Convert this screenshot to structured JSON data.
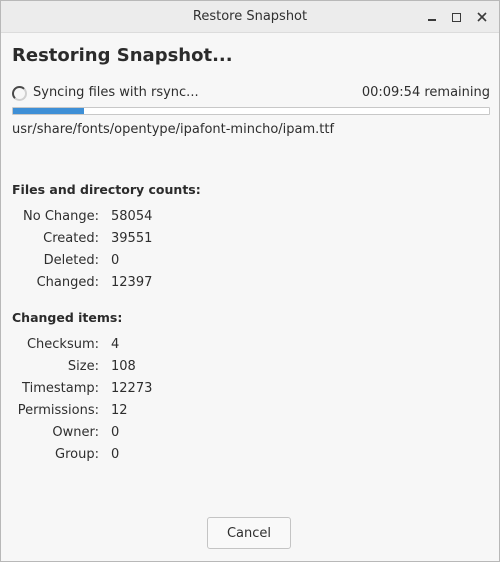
{
  "window": {
    "title": "Restore Snapshot",
    "controls": [
      "minimize-icon",
      "maximize-icon",
      "close-icon"
    ]
  },
  "heading": "Restoring Snapshot...",
  "status": {
    "text": "Syncing files with rsync...",
    "remaining": "00:09:54 remaining",
    "progress_fraction": 0.15,
    "progress_color": "#3e8fd6"
  },
  "current_file": "usr/share/fonts/opentype/ipafont-mincho/ipam.ttf",
  "counts": {
    "title": "Files and directory counts:",
    "rows": [
      {
        "label": "No Change:",
        "value": "58054"
      },
      {
        "label": "Created:",
        "value": "39551"
      },
      {
        "label": "Deleted:",
        "value": "0"
      },
      {
        "label": "Changed:",
        "value": "12397"
      }
    ]
  },
  "changed_items": {
    "title": "Changed items:",
    "rows": [
      {
        "label": "Checksum:",
        "value": "4"
      },
      {
        "label": "Size:",
        "value": "108"
      },
      {
        "label": "Timestamp:",
        "value": "12273"
      },
      {
        "label": "Permissions:",
        "value": "12"
      },
      {
        "label": "Owner:",
        "value": "0"
      },
      {
        "label": "Group:",
        "value": "0"
      }
    ]
  },
  "buttons": {
    "cancel": "Cancel"
  }
}
